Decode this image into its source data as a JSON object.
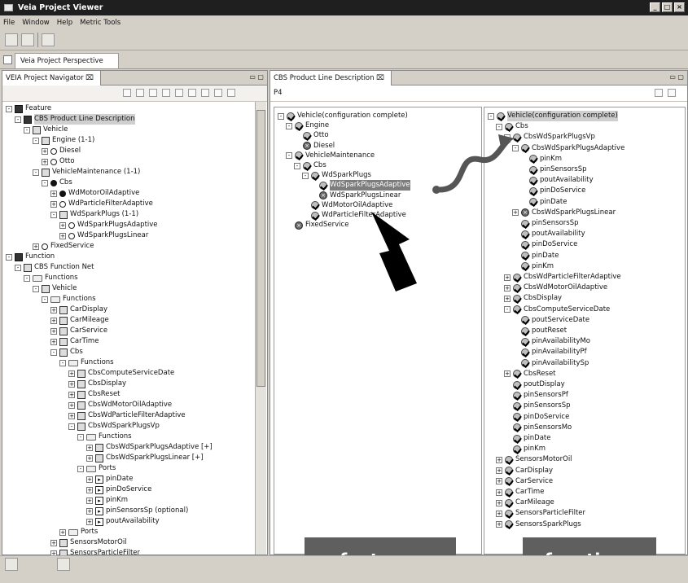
{
  "window": {
    "title": "Veia Project Viewer",
    "controls": [
      "_",
      "□",
      "×"
    ]
  },
  "menu": [
    "File",
    "Window",
    "Help",
    "Metric Tools"
  ],
  "perspective": {
    "tab": "Veia Project Perspective"
  },
  "navigator": {
    "tab": "VEIA Project Navigator ⌧",
    "rows": [
      {
        "text": "Feature",
        "level": 1,
        "exp": "-",
        "icon": "feat"
      },
      {
        "text": "CBS Product Line Description",
        "level": 2,
        "exp": "-",
        "icon": "feat",
        "sel": true
      },
      {
        "text": "Vehicle",
        "level": 3,
        "exp": "-",
        "icon": "fn"
      },
      {
        "text": "Engine (1-1)",
        "level": 4,
        "exp": "-",
        "icon": "fn"
      },
      {
        "text": "Diesel",
        "level": 5,
        "exp": "+",
        "icon": "circle"
      },
      {
        "text": "Otto",
        "level": 5,
        "exp": "+",
        "icon": "circle"
      },
      {
        "text": "VehicleMaintenance (1-1)",
        "level": 4,
        "exp": "-",
        "icon": "fn"
      },
      {
        "text": "Cbs",
        "level": 5,
        "exp": "-",
        "icon": "dot"
      },
      {
        "text": "WdMotorOilAdaptive",
        "level": 6,
        "exp": "+",
        "icon": "dot"
      },
      {
        "text": "WdParticleFilterAdaptive",
        "level": 6,
        "exp": "+",
        "icon": "circle"
      },
      {
        "text": "WdSparkPlugs (1-1)",
        "level": 6,
        "exp": "-",
        "icon": "fn"
      },
      {
        "text": "WdSparkPlugsAdaptive",
        "level": 7,
        "exp": "+",
        "icon": "circle"
      },
      {
        "text": "WdSparkPlugsLinear",
        "level": 7,
        "exp": "+",
        "icon": "circle"
      },
      {
        "text": "FixedService",
        "level": 4,
        "exp": "+",
        "icon": "circle"
      },
      {
        "text": "Function",
        "level": 1,
        "exp": "-",
        "icon": "feat"
      },
      {
        "text": "CBS Function Net",
        "level": 2,
        "exp": "-",
        "icon": "fn"
      },
      {
        "text": "Functions",
        "level": 3,
        "exp": "-",
        "icon": "folder"
      },
      {
        "text": "Vehicle",
        "level": 4,
        "exp": "-",
        "icon": "fn"
      },
      {
        "text": "Functions",
        "level": 5,
        "exp": "-",
        "icon": "folder"
      },
      {
        "text": "CarDisplay",
        "level": 6,
        "exp": "+",
        "icon": "fn"
      },
      {
        "text": "CarMileage",
        "level": 6,
        "exp": "+",
        "icon": "fn"
      },
      {
        "text": "CarService",
        "level": 6,
        "exp": "+",
        "icon": "fn"
      },
      {
        "text": "CarTime",
        "level": 6,
        "exp": "+",
        "icon": "fn"
      },
      {
        "text": "Cbs",
        "level": 6,
        "exp": "-",
        "icon": "fn"
      },
      {
        "text": "Functions",
        "level": 7,
        "exp": "-",
        "icon": "folder"
      },
      {
        "text": "CbsComputeServiceDate",
        "level": 8,
        "exp": "+",
        "icon": "fn"
      },
      {
        "text": "CbsDisplay",
        "level": 8,
        "exp": "+",
        "icon": "fn"
      },
      {
        "text": "CbsReset",
        "level": 8,
        "exp": "+",
        "icon": "fn"
      },
      {
        "text": "CbsWdMotorOilAdaptive",
        "level": 8,
        "exp": "+",
        "icon": "fn"
      },
      {
        "text": "CbsWdParticleFilterAdaptive",
        "level": 8,
        "exp": "+",
        "icon": "fn"
      },
      {
        "text": "CbsWdSparkPlugsVp",
        "level": 8,
        "exp": "-",
        "icon": "fn"
      },
      {
        "text": "Functions",
        "level": 9,
        "exp": "-",
        "icon": "folder"
      },
      {
        "text": "CbsWdSparkPlugsAdaptive [+]",
        "level": 10,
        "exp": "+",
        "icon": "fn"
      },
      {
        "text": "CbsWdSparkPlugsLinear [+]",
        "level": 10,
        "exp": "+",
        "icon": "fn"
      },
      {
        "text": "Ports",
        "level": 9,
        "exp": "-",
        "icon": "folder"
      },
      {
        "text": "pinDate",
        "level": 10,
        "exp": "+",
        "icon": "port"
      },
      {
        "text": "pinDoService",
        "level": 10,
        "exp": "+",
        "icon": "port"
      },
      {
        "text": "pinKm",
        "level": 10,
        "exp": "+",
        "icon": "port"
      },
      {
        "text": "pinSensorsSp (optional)",
        "level": 10,
        "exp": "+",
        "icon": "port"
      },
      {
        "text": "poutAvailability",
        "level": 10,
        "exp": "+",
        "icon": "port"
      },
      {
        "text": "Ports",
        "level": 7,
        "exp": "+",
        "icon": "folder"
      },
      {
        "text": "SensorsMotorOil",
        "level": 6,
        "exp": "+",
        "icon": "fn"
      },
      {
        "text": "SensorsParticleFilter",
        "level": 6,
        "exp": "+",
        "icon": "fn"
      }
    ]
  },
  "cbs": {
    "tab": "CBS Product Line Description ⌧",
    "p4": "P4",
    "features": [
      {
        "text": "Vehicle(configuration complete)",
        "level": 1,
        "exp": "-",
        "icon": "chk"
      },
      {
        "text": "Engine",
        "level": 2,
        "exp": "-",
        "icon": "chk"
      },
      {
        "text": "Otto",
        "level": 3,
        "exp": "",
        "icon": "chk"
      },
      {
        "text": "Diesel",
        "level": 3,
        "exp": "",
        "icon": "x"
      },
      {
        "text": "VehicleMaintenance",
        "level": 2,
        "exp": "-",
        "icon": "chk"
      },
      {
        "text": "Cbs",
        "level": 3,
        "exp": "-",
        "icon": "chk"
      },
      {
        "text": "WdSparkPlugs",
        "level": 4,
        "exp": "-",
        "icon": "chk"
      },
      {
        "text": "WdSparkPlugsAdaptive",
        "level": 5,
        "exp": "",
        "icon": "chk",
        "seldark": true
      },
      {
        "text": "WdSparkPlugsLinear",
        "level": 5,
        "exp": "",
        "icon": "x"
      },
      {
        "text": "WdMotorOilAdaptive",
        "level": 4,
        "exp": "",
        "icon": "chk"
      },
      {
        "text": "WdParticleFilterAdaptive",
        "level": 4,
        "exp": "",
        "icon": "chk"
      },
      {
        "text": "FixedService",
        "level": 2,
        "exp": "",
        "icon": "x"
      }
    ],
    "functions": [
      {
        "text": "Vehicle(configuration complete)",
        "level": 1,
        "exp": "-",
        "icon": "chk",
        "sel": true
      },
      {
        "text": "Cbs",
        "level": 2,
        "exp": "-",
        "icon": "chk"
      },
      {
        "text": "CbsWdSparkPlugsVp",
        "level": 3,
        "exp": "-",
        "icon": "chk"
      },
      {
        "text": "CbsWdSparkPlugsAdaptive",
        "level": 4,
        "exp": "-",
        "icon": "chk"
      },
      {
        "text": "pinKm",
        "level": 5,
        "exp": "",
        "icon": "chk"
      },
      {
        "text": "pinSensorsSp",
        "level": 5,
        "exp": "",
        "icon": "chk"
      },
      {
        "text": "poutAvailability",
        "level": 5,
        "exp": "",
        "icon": "chk"
      },
      {
        "text": "pinDoService",
        "level": 5,
        "exp": "",
        "icon": "chk"
      },
      {
        "text": "pinDate",
        "level": 5,
        "exp": "",
        "icon": "chk"
      },
      {
        "text": "CbsWdSparkPlugsLinear",
        "level": 4,
        "exp": "+",
        "icon": "x"
      },
      {
        "text": "pinSensorsSp",
        "level": 4,
        "exp": "",
        "icon": "chk"
      },
      {
        "text": "poutAvailability",
        "level": 4,
        "exp": "",
        "icon": "chk"
      },
      {
        "text": "pinDoService",
        "level": 4,
        "exp": "",
        "icon": "chk"
      },
      {
        "text": "pinDate",
        "level": 4,
        "exp": "",
        "icon": "chk"
      },
      {
        "text": "pinKm",
        "level": 4,
        "exp": "",
        "icon": "chk"
      },
      {
        "text": "CbsWdParticleFilterAdaptive",
        "level": 3,
        "exp": "+",
        "icon": "chk"
      },
      {
        "text": "CbsWdMotorOilAdaptive",
        "level": 3,
        "exp": "+",
        "icon": "chk"
      },
      {
        "text": "CbsDisplay",
        "level": 3,
        "exp": "+",
        "icon": "chk"
      },
      {
        "text": "CbsComputeServiceDate",
        "level": 3,
        "exp": "-",
        "icon": "chk"
      },
      {
        "text": "poutServiceDate",
        "level": 4,
        "exp": "",
        "icon": "chk"
      },
      {
        "text": "poutReset",
        "level": 4,
        "exp": "",
        "icon": "chk"
      },
      {
        "text": "pinAvailabilityMo",
        "level": 4,
        "exp": "",
        "icon": "chk"
      },
      {
        "text": "pinAvailabilityPf",
        "level": 4,
        "exp": "",
        "icon": "chk"
      },
      {
        "text": "pinAvailabilitySp",
        "level": 4,
        "exp": "",
        "icon": "chk"
      },
      {
        "text": "CbsReset",
        "level": 3,
        "exp": "+",
        "icon": "chk"
      },
      {
        "text": "poutDisplay",
        "level": 3,
        "exp": "",
        "icon": "chk"
      },
      {
        "text": "pinSensorsPf",
        "level": 3,
        "exp": "",
        "icon": "chk"
      },
      {
        "text": "pinSensorsSp",
        "level": 3,
        "exp": "",
        "icon": "chk"
      },
      {
        "text": "pinDoService",
        "level": 3,
        "exp": "",
        "icon": "chk"
      },
      {
        "text": "pinSensorsMo",
        "level": 3,
        "exp": "",
        "icon": "chk"
      },
      {
        "text": "pinDate",
        "level": 3,
        "exp": "",
        "icon": "chk"
      },
      {
        "text": "pinKm",
        "level": 3,
        "exp": "",
        "icon": "chk"
      },
      {
        "text": "SensorsMotorOil",
        "level": 2,
        "exp": "+",
        "icon": "chk"
      },
      {
        "text": "CarDisplay",
        "level": 2,
        "exp": "+",
        "icon": "chk"
      },
      {
        "text": "CarService",
        "level": 2,
        "exp": "+",
        "icon": "chk"
      },
      {
        "text": "CarTime",
        "level": 2,
        "exp": "+",
        "icon": "chk"
      },
      {
        "text": "CarMileage",
        "level": 2,
        "exp": "+",
        "icon": "chk"
      },
      {
        "text": "SensorsParticleFilter",
        "level": 2,
        "exp": "+",
        "icon": "chk"
      },
      {
        "text": "SensorsSparkPlugs",
        "level": 2,
        "exp": "+",
        "icon": "chk"
      }
    ]
  },
  "labels": {
    "features": "features",
    "functions": "functions"
  }
}
